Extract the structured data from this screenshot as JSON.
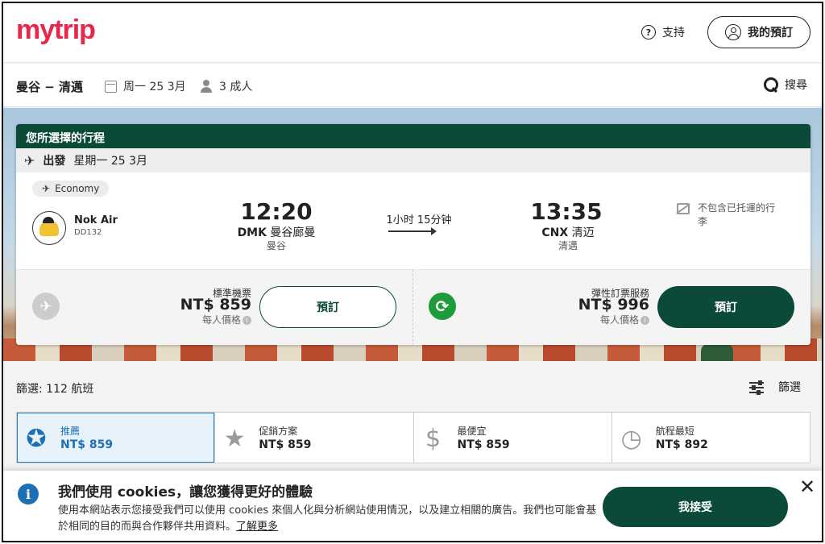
{
  "header": {
    "logo": "mytrip",
    "support_label": "支持",
    "my_booking_label": "我的預訂"
  },
  "search": {
    "route": "曼谷 − 清邁",
    "date": "周一 25 3月",
    "passengers": "3 成人",
    "search_label": "搜尋"
  },
  "itinerary": {
    "title": "您所選擇的行程",
    "departure_label": "出發",
    "departure_date": "星期一 25 3月",
    "cabin": "Economy",
    "airline": "Nok Air",
    "flight_number": "DD132",
    "dep_time": "12:20",
    "dep_code": "DMK",
    "dep_airport": "曼谷廊曼",
    "dep_city": "曼谷",
    "duration": "1小时 15分钟",
    "arr_time": "13:35",
    "arr_code": "CNX",
    "arr_airport": "清迈",
    "arr_city": "清邁",
    "baggage_note": "不包含已托運的行李"
  },
  "fares": [
    {
      "label": "標準機票",
      "price": "NT$ 859",
      "per_person": "每人價格",
      "button": "預訂"
    },
    {
      "label": "彈性訂票服務",
      "price": "NT$ 996",
      "per_person": "每人價格",
      "button": "預訂"
    }
  ],
  "filter": {
    "count_label": "篩選: 112 航班",
    "filter_label": "篩選"
  },
  "sort_tabs": [
    {
      "label": "推薦",
      "price": "NT$ 859",
      "icon": "award-ribbon-icon"
    },
    {
      "label": "促銷方案",
      "price": "NT$ 859",
      "icon": "star-icon"
    },
    {
      "label": "最便宜",
      "price": "NT$ 859",
      "icon": "dollar-icon"
    },
    {
      "label": "航程最短",
      "price": "NT$ 892",
      "icon": "clock-icon"
    }
  ],
  "cookie": {
    "title": "我們使用 cookies，讓您獲得更好的體驗",
    "body": "使用本網站表示您接受我們可以使用 cookies 來個人化與分析網站使用情況，以及建立相關的廣告。我們也可能會基於相同的目的而與合作夥伴共用資料。",
    "learn_more": "了解更多",
    "accept": "我接受"
  },
  "colors": {
    "brand": "#e8264a",
    "primary": "#0b4a38",
    "accent_blue": "#1f6fb5",
    "flex_green": "#1e9b3a"
  }
}
